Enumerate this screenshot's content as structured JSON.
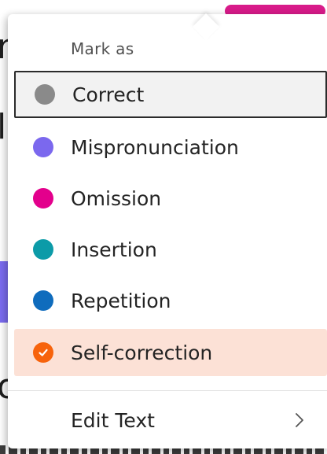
{
  "menu": {
    "header": "Mark as",
    "items": [
      {
        "label": "Correct",
        "color": "#8a8a8a",
        "state": "focused"
      },
      {
        "label": "Mispronunciation",
        "color": "#7b68ee",
        "state": "normal"
      },
      {
        "label": "Omission",
        "color": "#e3008c",
        "state": "normal"
      },
      {
        "label": "Insertion",
        "color": "#0c9ba8",
        "state": "normal"
      },
      {
        "label": "Repetition",
        "color": "#0f6cbd",
        "state": "normal"
      },
      {
        "label": "Self-correction",
        "color": "#f7630c",
        "state": "checked",
        "icon": "checkmark-icon"
      }
    ],
    "edit_text": {
      "label": "Edit Text",
      "icon": "chevron-right-icon"
    }
  }
}
